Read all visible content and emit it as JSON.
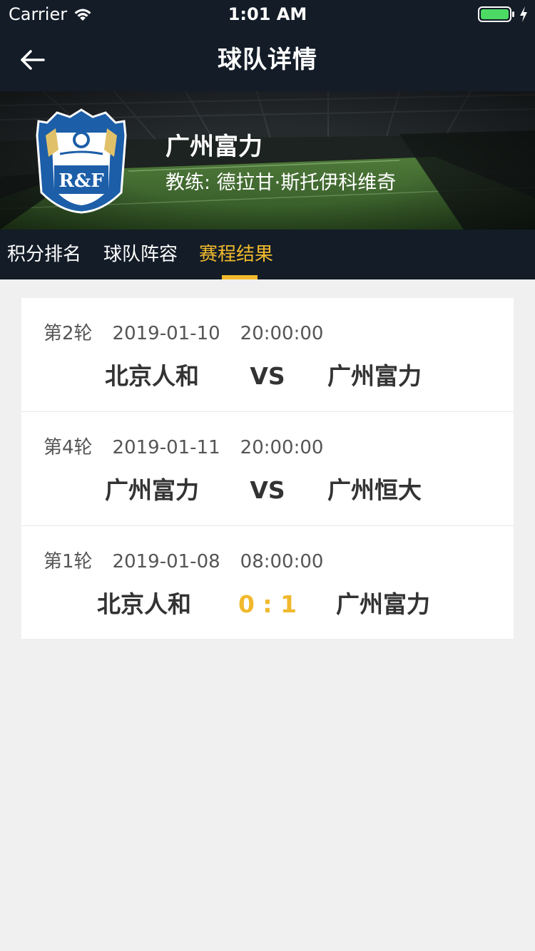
{
  "status_bar": {
    "carrier": "Carrier",
    "time": "1:01 AM",
    "wifi_icon": "wifi-icon",
    "battery_icon": "battery-icon",
    "charging_icon": "bolt-icon",
    "battery_color": "#4cd964"
  },
  "nav": {
    "back_icon": "arrow-left-icon",
    "title": "球队详情"
  },
  "team": {
    "name": "广州富力",
    "coach": "教练: 德拉甘·斯托伊科维奇",
    "logo_text": "R&F"
  },
  "tabs": [
    {
      "label": "积分排名",
      "active": false
    },
    {
      "label": "球队阵容",
      "active": false
    },
    {
      "label": "赛程结果",
      "active": true
    }
  ],
  "matches": [
    {
      "round": "第2轮",
      "date": "2019-01-10",
      "time": "20:00:00",
      "home": "北京人和",
      "center": "VS",
      "away": "广州富力",
      "finished": false
    },
    {
      "round": "第4轮",
      "date": "2019-01-11",
      "time": "20:00:00",
      "home": "广州富力",
      "center": "VS",
      "away": "广州恒大",
      "finished": false
    },
    {
      "round": "第1轮",
      "date": "2019-01-08",
      "time": "08:00:00",
      "home": "北京人和",
      "center": "0 : 1",
      "away": "广州富力",
      "finished": true
    }
  ],
  "colors": {
    "header_bg": "#131c27",
    "accent": "#f0b92d",
    "page_bg": "#f0f0f0",
    "card_bg": "#ffffff"
  }
}
